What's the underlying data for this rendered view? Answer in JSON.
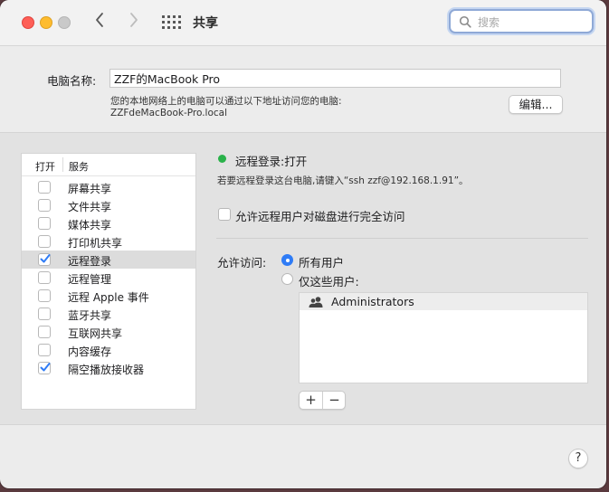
{
  "window": {
    "title": "共享",
    "search_placeholder": "搜索"
  },
  "computer_name": {
    "label": "电脑名称:",
    "value": "ZZF的MacBook Pro",
    "description": "您的本地网络上的电脑可以通过以下地址访问您的电脑:",
    "hostname": "ZZFdeMacBook-Pro.local",
    "edit_label": "编辑..."
  },
  "services": {
    "col_open": "打开",
    "col_service": "服务",
    "items": [
      {
        "label": "屏幕共享",
        "checked": false,
        "selected": false
      },
      {
        "label": "文件共享",
        "checked": false,
        "selected": false
      },
      {
        "label": "媒体共享",
        "checked": false,
        "selected": false
      },
      {
        "label": "打印机共享",
        "checked": false,
        "selected": false
      },
      {
        "label": "远程登录",
        "checked": true,
        "selected": true
      },
      {
        "label": "远程管理",
        "checked": false,
        "selected": false
      },
      {
        "label": "远程 Apple 事件",
        "checked": false,
        "selected": false
      },
      {
        "label": "蓝牙共享",
        "checked": false,
        "selected": false
      },
      {
        "label": "互联网共享",
        "checked": false,
        "selected": false
      },
      {
        "label": "内容缓存",
        "checked": false,
        "selected": false
      },
      {
        "label": "隔空播放接收器",
        "checked": true,
        "selected": false
      }
    ]
  },
  "detail": {
    "status": "远程登录:打开",
    "status_color": "#2ab24a",
    "hint": "若要远程登录这台电脑,请键入“ssh zzf@192.168.1.91”。",
    "disk_access_label": "允许远程用户对磁盘进行完全访问",
    "access_label": "允许访问:",
    "radio_all_label": "所有用户",
    "radio_some_label": "仅这些用户:",
    "users": [
      "Administrators"
    ],
    "add_label": "+",
    "remove_label": "−"
  },
  "help_label": "?",
  "accent_color": "#2f7cf6"
}
